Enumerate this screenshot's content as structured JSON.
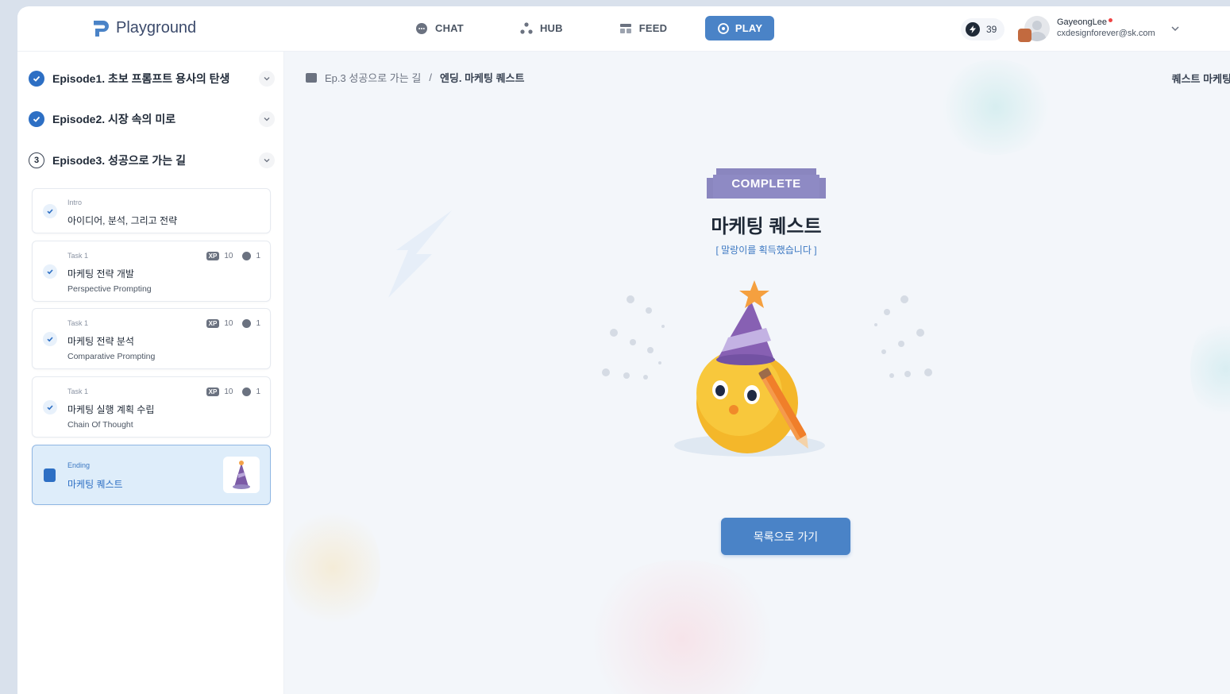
{
  "header": {
    "logo_text": "Playground",
    "nav": [
      {
        "label": "CHAT",
        "icon": "chat-icon"
      },
      {
        "label": "HUB",
        "icon": "hub-icon"
      },
      {
        "label": "FEED",
        "icon": "feed-icon"
      },
      {
        "label": "PLAY",
        "icon": "play-icon",
        "active": true
      }
    ],
    "points": "39",
    "user": {
      "name": "GayeongLee",
      "email": "cxdesignforever@sk.com"
    }
  },
  "sidebar": {
    "episodes": [
      {
        "title": "Episode1. 초보 프롬프트 용사의 탄생",
        "status": "complete"
      },
      {
        "title": "Episode2. 시장 속의 미로",
        "status": "complete"
      },
      {
        "title": "Episode3. 성공으로 가는 길",
        "status": "in-progress",
        "number": "3"
      }
    ],
    "tasks": [
      {
        "tag": "Intro",
        "title": "아이디어, 분석, 그리고 전략"
      },
      {
        "tag": "Task 1",
        "title": "마케팅 전략 개발",
        "subtitle": "Perspective Prompting",
        "xp_label": "XP",
        "xp": "10",
        "coin": "1"
      },
      {
        "tag": "Task 1",
        "title": "마케팅 전략 분석",
        "subtitle": "Comparative Prompting",
        "xp_label": "XP",
        "xp": "10",
        "coin": "1"
      },
      {
        "tag": "Task 1",
        "title": "마케팅 실행 계획 수립",
        "subtitle": "Chain Of Thought",
        "xp_label": "XP",
        "xp": "10",
        "coin": "1"
      },
      {
        "tag": "Ending",
        "title": "마케팅 퀘스트"
      }
    ]
  },
  "main": {
    "breadcrumb": {
      "parent": "Ep.3 성공으로 가는 길",
      "separator": "/",
      "current": "엔딩. 마케팅 퀘스트"
    },
    "right_label": "퀘스트 마케팅",
    "complete_label": "COMPLETE",
    "quest_title": "마케팅 퀘스트",
    "quest_subtitle": "[ 말랑이를 획득했습니다 ]",
    "back_button": "목록으로 가기"
  },
  "colors": {
    "accent": "#4a83c7",
    "complete_banner": "#8a86bf",
    "check": "#2d6fc4"
  }
}
